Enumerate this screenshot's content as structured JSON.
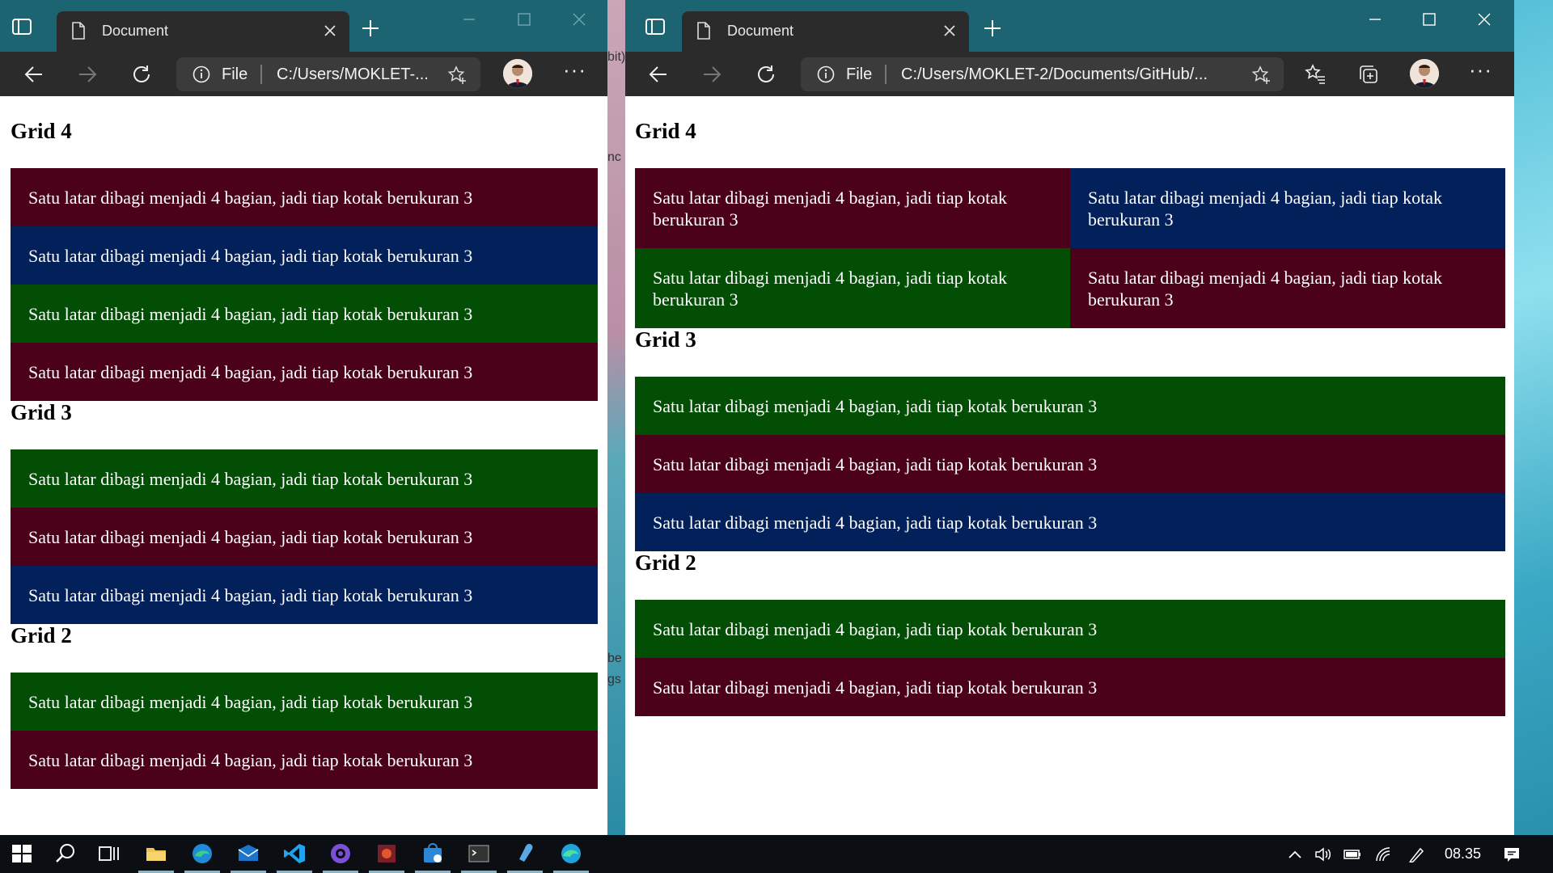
{
  "left_window": {
    "tab_title": "Document",
    "address_scheme": "File",
    "address_url": "C:/Users/MOKLET-...",
    "sections": [
      {
        "heading": "Grid 4",
        "boxes": [
          {
            "text": "Satu latar dibagi menjadi 4 bagian, jadi tiap kotak berukuran 3",
            "color": "maroon"
          },
          {
            "text": "Satu latar dibagi menjadi 4 bagian, jadi tiap kotak berukuran 3",
            "color": "navy"
          },
          {
            "text": "Satu latar dibagi menjadi 4 bagian, jadi tiap kotak berukuran 3",
            "color": "green"
          },
          {
            "text": "Satu latar dibagi menjadi 4 bagian, jadi tiap kotak berukuran 3",
            "color": "maroon"
          }
        ]
      },
      {
        "heading": "Grid 3",
        "boxes": [
          {
            "text": "Satu latar dibagi menjadi 4 bagian, jadi tiap kotak berukuran 3",
            "color": "green"
          },
          {
            "text": "Satu latar dibagi menjadi 4 bagian, jadi tiap kotak berukuran 3",
            "color": "maroon"
          },
          {
            "text": "Satu latar dibagi menjadi 4 bagian, jadi tiap kotak berukuran 3",
            "color": "navy"
          }
        ]
      },
      {
        "heading": "Grid 2",
        "boxes": [
          {
            "text": "Satu latar dibagi menjadi 4 bagian, jadi tiap kotak berukuran 3",
            "color": "green"
          },
          {
            "text": "Satu latar dibagi menjadi 4 bagian, jadi tiap kotak berukuran 3",
            "color": "maroon"
          }
        ]
      }
    ]
  },
  "right_window": {
    "tab_title": "Document",
    "address_scheme": "File",
    "address_url": "C:/Users/MOKLET-2/Documents/GitHub/...",
    "sections": [
      {
        "heading": "Grid 4",
        "boxes": [
          {
            "text": "Satu latar dibagi menjadi 4 bagian, jadi tiap kotak berukuran 3",
            "color": "maroon"
          },
          {
            "text": "Satu latar dibagi menjadi 4 bagian, jadi tiap kotak berukuran 3",
            "color": "navy"
          },
          {
            "text": "Satu latar dibagi menjadi 4 bagian, jadi tiap kotak berukuran 3",
            "color": "green"
          },
          {
            "text": "Satu latar dibagi menjadi 4 bagian, jadi tiap kotak berukuran 3",
            "color": "maroon"
          }
        ]
      },
      {
        "heading": "Grid 3",
        "boxes": [
          {
            "text": "Satu latar dibagi menjadi 4 bagian, jadi tiap kotak berukuran 3",
            "color": "green"
          },
          {
            "text": "Satu latar dibagi menjadi 4 bagian, jadi tiap kotak berukuran 3",
            "color": "maroon"
          },
          {
            "text": "Satu latar dibagi menjadi 4 bagian, jadi tiap kotak berukuran 3",
            "color": "navy"
          }
        ]
      },
      {
        "heading": "Grid 2",
        "boxes": [
          {
            "text": "Satu latar dibagi menjadi 4 bagian, jadi tiap kotak berukuran 3",
            "color": "green"
          },
          {
            "text": "Satu latar dibagi menjadi 4 bagian, jadi tiap kotak berukuran 3",
            "color": "maroon"
          }
        ]
      }
    ]
  },
  "background_text": [
    "bit)",
    "nc",
    "be",
    "gs"
  ],
  "taskbar": {
    "clock": "08.35",
    "apps": [
      "windows-start-icon",
      "search-icon",
      "task-view-icon",
      "file-explorer-icon",
      "edge-dev-icon",
      "mail-icon",
      "vscode-icon",
      "github-desktop-icon",
      "app-red-icon",
      "store-icon",
      "terminal-icon",
      "paint-icon",
      "edge-icon"
    ],
    "tray": [
      "chevron-up-icon",
      "volume-icon",
      "battery-icon",
      "wifi-icon",
      "pen-icon",
      "notification-icon"
    ]
  },
  "colors": {
    "maroon": "#4c011a",
    "navy": "#02205a",
    "green": "#034e05",
    "titlebar": "#1d6472",
    "toolbar": "#2b2b2b"
  }
}
